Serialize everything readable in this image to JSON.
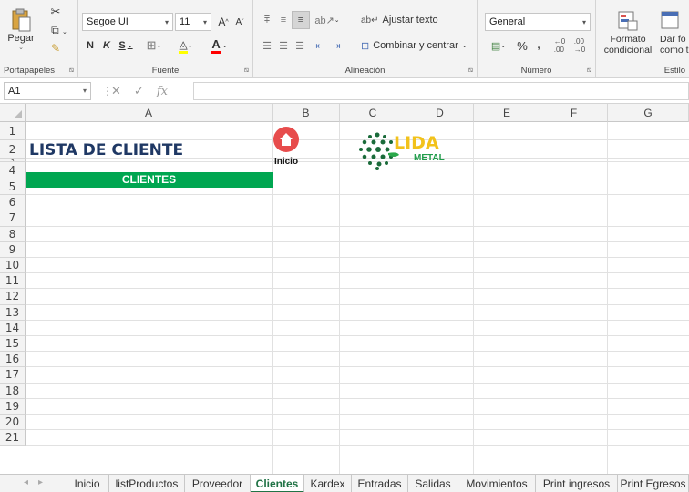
{
  "ribbon": {
    "clipboard": {
      "paste_label": "Pegar",
      "group_label": "Portapapeles"
    },
    "font": {
      "font_name": "Segoe UI",
      "font_size": "11",
      "bold_glyph": "N",
      "italic_glyph": "K",
      "underline_glyph": "S",
      "grow_glyph": "A",
      "shrink_glyph": "A",
      "color_glyph": "A",
      "group_label": "Fuente"
    },
    "alignment": {
      "wrap_label": "Ajustar texto",
      "merge_label": "Combinar y centrar",
      "group_label": "Alineación"
    },
    "number": {
      "format_value": "General",
      "percent_glyph": "%",
      "comma_glyph": ",",
      "group_label": "Número"
    },
    "styles": {
      "cond_format_line1": "Formato",
      "cond_format_line2": "condicional",
      "table_format_line1": "Dar fo",
      "table_format_line2": "como t",
      "group_label": "Estilo"
    }
  },
  "formula_bar": {
    "name_box": "A1",
    "fx_label": "fx",
    "content": ""
  },
  "columns": [
    {
      "label": "A"
    },
    {
      "label": "B"
    },
    {
      "label": "C"
    },
    {
      "label": "D"
    },
    {
      "label": "E"
    },
    {
      "label": "F"
    },
    {
      "label": "G"
    }
  ],
  "rows": [
    "1",
    "2",
    "3",
    "4",
    "5",
    "6",
    "7",
    "8",
    "9",
    "10",
    "11",
    "12",
    "13",
    "14",
    "15",
    "16",
    "17",
    "18",
    "19",
    "20",
    "21"
  ],
  "sheet": {
    "title": "LISTA DE CLIENTE",
    "header_band": "CLIENTES",
    "home_button_label": "Inicio",
    "logo_text_main": "LIDA",
    "logo_text_sub": "METAL",
    "accent_green": "#00a651",
    "title_color": "#1f3864"
  },
  "tabs": {
    "items": [
      "Inicio",
      "listProductos",
      "Proveedor",
      "Clientes",
      "Kardex",
      "Entradas",
      "Salidas",
      "Movimientos",
      "Print ingresos",
      "Print Egresos"
    ],
    "active": "Clientes"
  }
}
